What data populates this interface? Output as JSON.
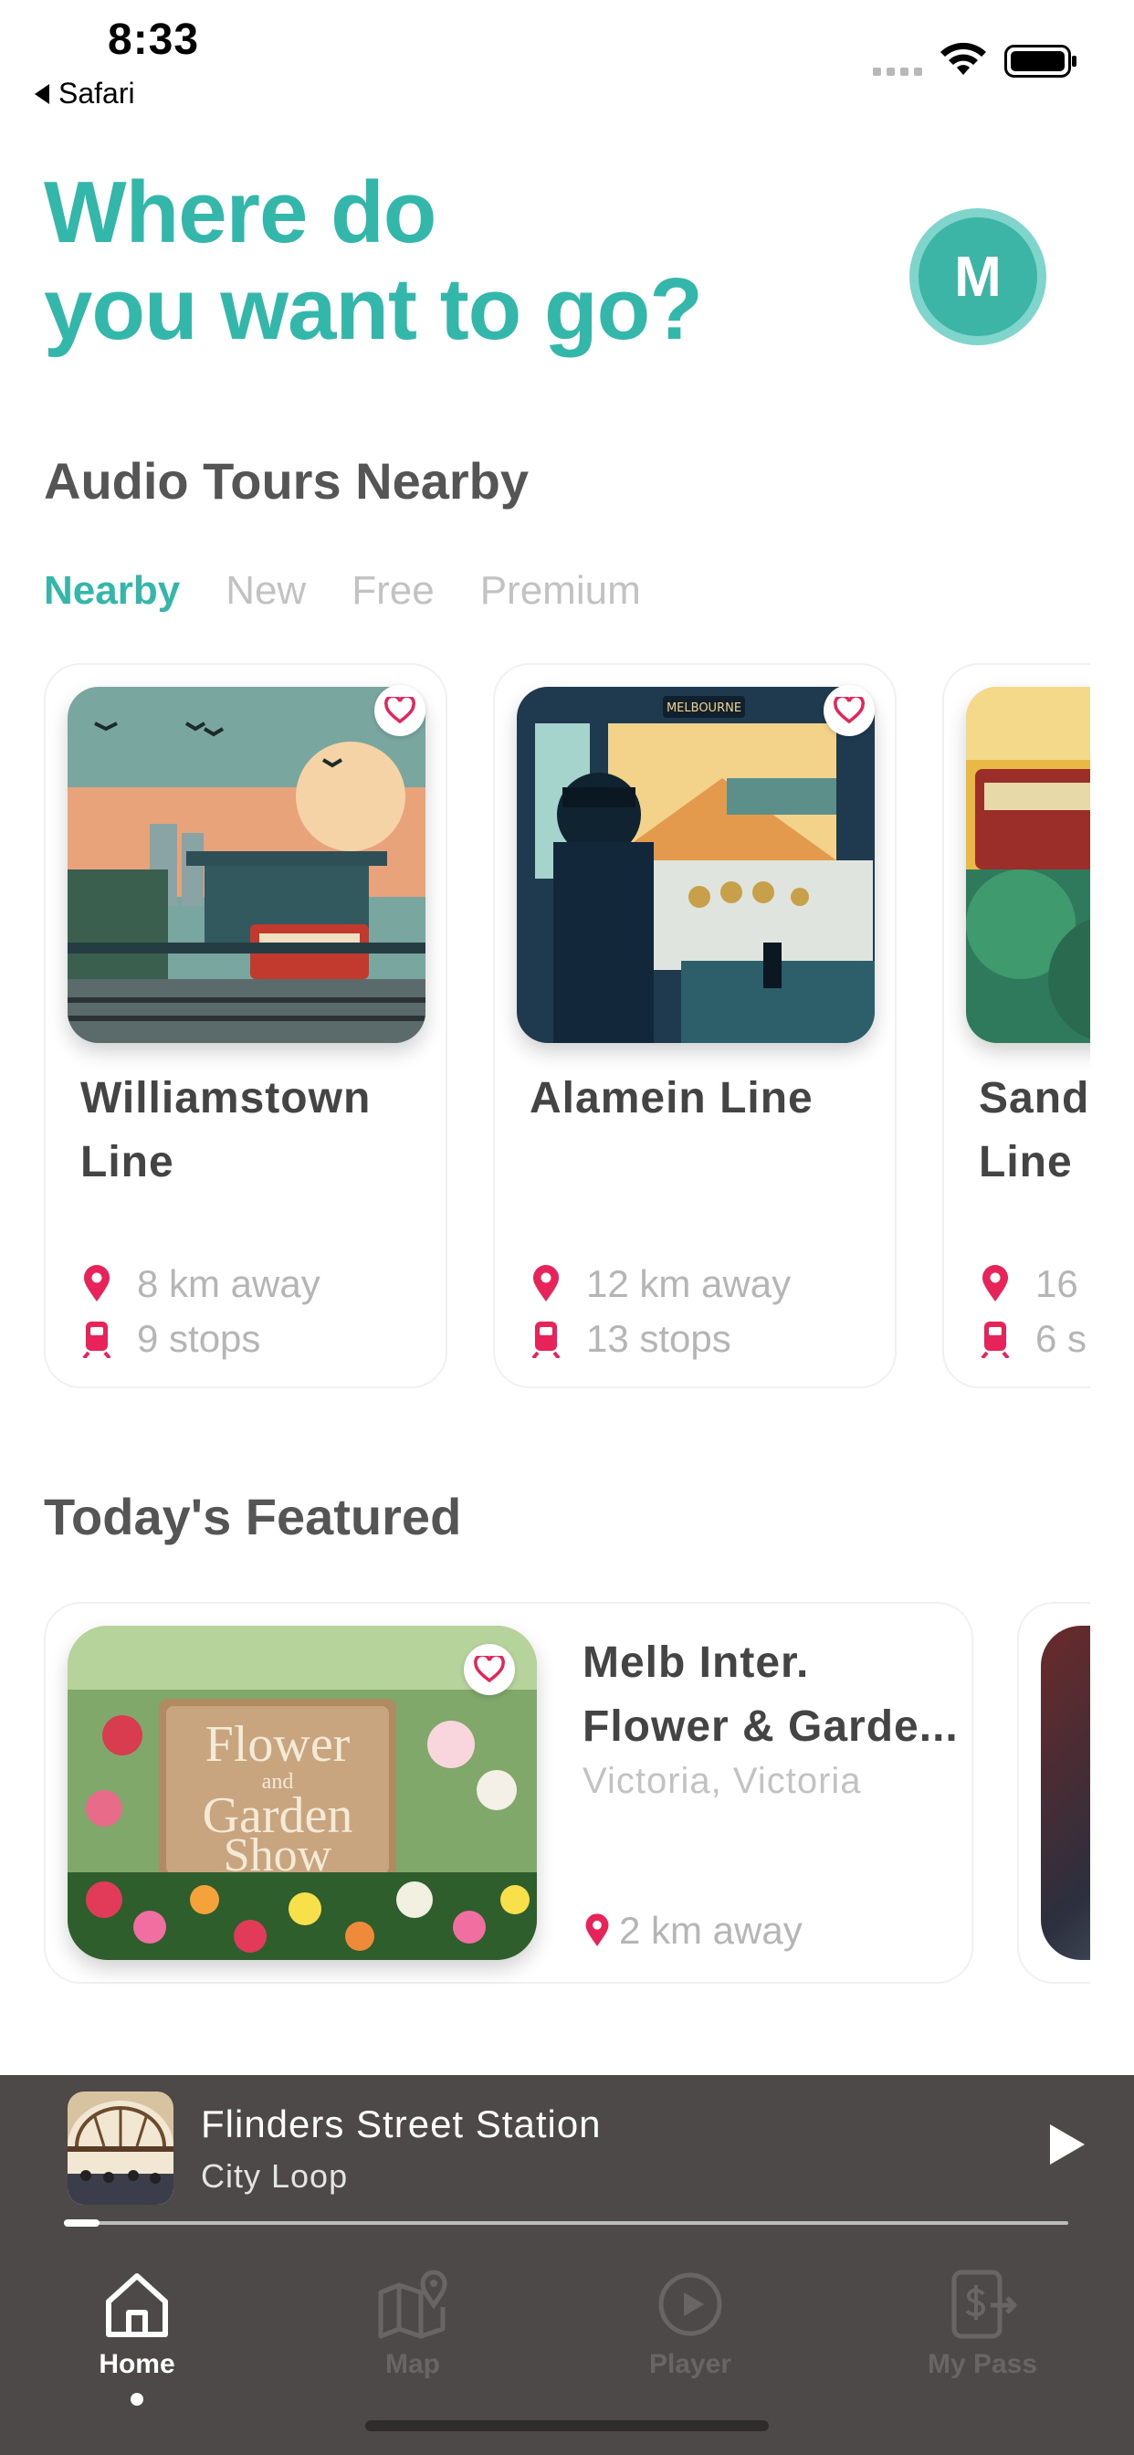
{
  "status_bar": {
    "time": "8:33",
    "back_label": "Safari"
  },
  "header": {
    "headline_line1": "Where do",
    "headline_line2": "you want to go?",
    "avatar_initial": "M"
  },
  "colors": {
    "accent": "#33b7aa",
    "pin": "#e8235a",
    "muted_text": "#b5b5b5",
    "player_bg": "#4e4949"
  },
  "nearby": {
    "section_title": "Audio Tours Nearby",
    "tabs": [
      {
        "label": "Nearby",
        "active": true
      },
      {
        "label": "New",
        "active": false
      },
      {
        "label": "Free",
        "active": false
      },
      {
        "label": "Premium",
        "active": false
      }
    ],
    "cards": [
      {
        "title_line1": "Williamstown",
        "title_line2": "Line",
        "distance": "8 km away",
        "stops": "9 stops",
        "favorite_icon": "heart-outline-icon"
      },
      {
        "title_line1": "Alamein Line",
        "title_line2": "",
        "distance": "12 km away",
        "stops": "13 stops",
        "favorite_icon": "heart-outline-icon",
        "image_sign": "MELBOURNE"
      },
      {
        "title_line1": "Sand",
        "title_line2": "Line",
        "distance": "16",
        "stops": "6 s"
      }
    ]
  },
  "featured": {
    "section_title": "Today's Featured",
    "card": {
      "title_line1": "Melb Inter.",
      "title_line2": "Flower & Garde...",
      "location": "Victoria, Victoria",
      "distance": "2 km away",
      "image_sign": [
        "Flower",
        "and",
        "Garden",
        "Show"
      ]
    }
  },
  "now_playing": {
    "title": "Flinders Street Station",
    "subtitle": "City Loop",
    "progress": 0.035,
    "play_icon": "play-icon"
  },
  "nav": {
    "items": [
      {
        "label": "Home",
        "icon": "home-icon",
        "active": true
      },
      {
        "label": "Map",
        "icon": "map-icon",
        "active": false
      },
      {
        "label": "Player",
        "icon": "play-circle-icon",
        "active": false
      },
      {
        "label": "My Pass",
        "icon": "pass-icon",
        "active": false
      }
    ]
  }
}
